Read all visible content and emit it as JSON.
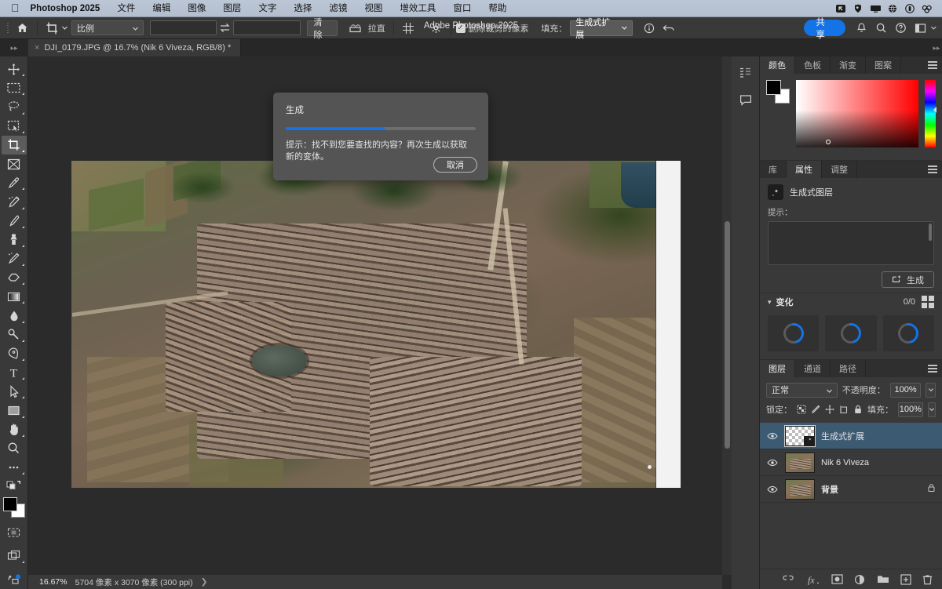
{
  "macmenu": {
    "app": "Photoshop 2025",
    "items": [
      "文件",
      "编辑",
      "图像",
      "图层",
      "文字",
      "选择",
      "滤镜",
      "视图",
      "增效工具",
      "窗口",
      "帮助"
    ],
    "status_icons": [
      "screenshot-icon",
      "shield-icon",
      "display-icon",
      "network-icon",
      "battery-icon",
      "dropbox-icon"
    ]
  },
  "window": {
    "title": "Adobe Photoshop 2025"
  },
  "options_bar": {
    "home_icon": "home-icon",
    "tool_icon": "crop-tool-icon",
    "ratio_select": "比例",
    "width_value": "",
    "height_value": "",
    "swap_icon": "swap-icon",
    "clear_label": "清除",
    "straighten_label": "拉直",
    "overlay_icon": "grid-overlay-icon",
    "settings_icon": "gear-icon",
    "delete_cropped_label": "删除裁剪的像素",
    "fill_label": "填充：",
    "fill_value": "生成式扩展",
    "info_icon": "info-icon",
    "undo_icon": "undo-icon",
    "share_label": "共享",
    "bell_icon": "bell-icon",
    "search_icon": "search-icon",
    "help_icon": "help-icon",
    "workspace_icon": "workspace-icon"
  },
  "document_tab": {
    "label": "DJI_0179.JPG @ 16.7% (Nik 6 Viveza, RGB/8) *",
    "close_icon": "close-icon"
  },
  "toolbar": {
    "tools": [
      {
        "name": "move-tool",
        "glyph": "move"
      },
      {
        "name": "marquee-tool",
        "glyph": "marquee"
      },
      {
        "name": "lasso-tool",
        "glyph": "lasso"
      },
      {
        "name": "object-selection-tool",
        "glyph": "objsel"
      },
      {
        "name": "crop-tool",
        "glyph": "crop",
        "active": true
      },
      {
        "name": "frame-tool",
        "glyph": "frame"
      },
      {
        "name": "eyedropper-tool",
        "glyph": "eyedropper"
      },
      {
        "name": "spot-healing-tool",
        "glyph": "heal"
      },
      {
        "name": "brush-tool",
        "glyph": "brush"
      },
      {
        "name": "clone-stamp-tool",
        "glyph": "stamp"
      },
      {
        "name": "history-brush-tool",
        "glyph": "historybrush"
      },
      {
        "name": "eraser-tool",
        "glyph": "eraser"
      },
      {
        "name": "gradient-tool",
        "glyph": "gradient"
      },
      {
        "name": "blur-tool",
        "glyph": "blur"
      },
      {
        "name": "dodge-tool",
        "glyph": "dodge"
      },
      {
        "name": "pen-tool",
        "glyph": "pen"
      },
      {
        "name": "type-tool",
        "glyph": "type"
      },
      {
        "name": "path-selection-tool",
        "glyph": "pathsel"
      },
      {
        "name": "rectangle-tool",
        "glyph": "rect"
      },
      {
        "name": "hand-tool",
        "glyph": "hand"
      },
      {
        "name": "zoom-tool",
        "glyph": "zoom"
      },
      {
        "name": "edit-toolbar",
        "glyph": "dots"
      }
    ],
    "foreground_color": "#000000",
    "background_color": "#ffffff",
    "quickmask_icon": "quick-mask-icon",
    "screenmode_icon": "screen-mode-icon",
    "share-icon": "cloud-share-icon"
  },
  "dialog": {
    "title": "生成",
    "progress_percent": 52,
    "hint": "提示：找不到您要查找的内容？再次生成以获取新的变体。",
    "cancel_label": "取消",
    "accent_color": "#1473e6"
  },
  "dock_rail": {
    "icons": [
      "history-icon",
      "comment-icon"
    ]
  },
  "color_panel": {
    "tabs": [
      "颜色",
      "色板",
      "渐变",
      "图案"
    ],
    "active_tab": "颜色",
    "menu_icon": "panel-menu-icon"
  },
  "properties_panel": {
    "tabs": [
      "库",
      "属性",
      "调整"
    ],
    "active_tab": "属性",
    "layer_type_icon": "generative-layer-icon",
    "layer_type": "生成式图层",
    "prompt_label": "提示：",
    "prompt_value": "",
    "generate_icon": "generate-icon",
    "generate_label": "生成",
    "variations_label": "变化",
    "variations_count": "0/0",
    "grid_icon": "grid-view-icon",
    "variation_thumbs": [
      "loading",
      "loading",
      "loading"
    ]
  },
  "layers_panel": {
    "tabs": [
      "图层",
      "通道",
      "路径"
    ],
    "active_tab": "图层",
    "blend_mode": "正常",
    "opacity_label": "不透明度：",
    "opacity_value": "100%",
    "lock_label": "锁定：",
    "lock_icons": [
      "lock-transparency-icon",
      "lock-image-icon",
      "lock-position-icon",
      "lock-artboard-icon",
      "lock-all-icon"
    ],
    "fill_label": "填充：",
    "fill_value": "100%",
    "layers": [
      {
        "name": "生成式扩展",
        "visible": true,
        "selected": true,
        "thumb": "checker",
        "badge": "generative-badge-icon",
        "locked": false,
        "bold": false
      },
      {
        "name": "Nik 6 Viveza",
        "visible": true,
        "selected": false,
        "thumb": "photo",
        "locked": false,
        "bold": false
      },
      {
        "name": "背景",
        "visible": true,
        "selected": false,
        "thumb": "photo",
        "locked": true,
        "bold": true
      }
    ],
    "bottom_icons": [
      "link-layers-icon",
      "fx-icon",
      "add-mask-icon",
      "adjustment-layer-icon",
      "new-group-icon",
      "new-layer-icon",
      "delete-layer-icon"
    ]
  },
  "status_bar": {
    "zoom": "16.67%",
    "dimensions": "5704 像素 x 3070 像素 (300 ppi)",
    "arrow": "❯"
  }
}
